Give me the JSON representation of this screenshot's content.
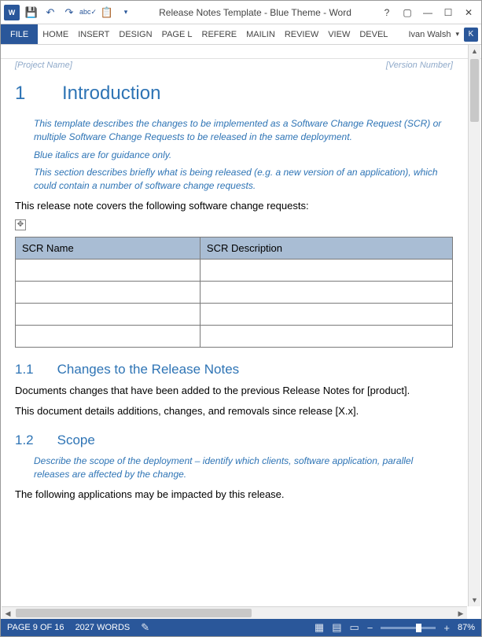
{
  "window": {
    "title": "Release Notes Template - Blue Theme - Word",
    "user": "Ivan Walsh",
    "user_initial": "K"
  },
  "ribbon": {
    "file": "FILE",
    "tabs": [
      "HOME",
      "INSERT",
      "DESIGN",
      "PAGE L",
      "REFERE",
      "MAILIN",
      "REVIEW",
      "VIEW",
      "DEVEL"
    ]
  },
  "doc": {
    "project_field": "[Project Name]",
    "version_field": "[Version Number]",
    "h1_num": "1",
    "h1_text": "Introduction",
    "note1": "This template describes the changes to be implemented as a Software Change Request (SCR) or multiple Software Change Requests to be released in the same deployment.",
    "note2": "Blue italics are for guidance only.",
    "note3": "This section describes briefly what is being released (e.g. a new version of an application), which could contain a number of software change requests.",
    "body1": "This release note covers the following software change requests:",
    "table": {
      "h1": "SCR Name",
      "h2": "SCR Description"
    },
    "h11_num": "1.1",
    "h11_text": "Changes to the Release Notes",
    "body2": "Documents changes that have been added to the previous Release Notes for [product].",
    "body3": "This document details additions, changes, and removals since release [X.x].",
    "h12_num": "1.2",
    "h12_text": "Scope",
    "note4": "Describe the scope of the deployment – identify which clients, software application, parallel releases are affected by the change.",
    "body4": "The following applications may be impacted by this release."
  },
  "status": {
    "page": "PAGE 9 OF 16",
    "words": "2027 WORDS",
    "zoom": "87%"
  }
}
